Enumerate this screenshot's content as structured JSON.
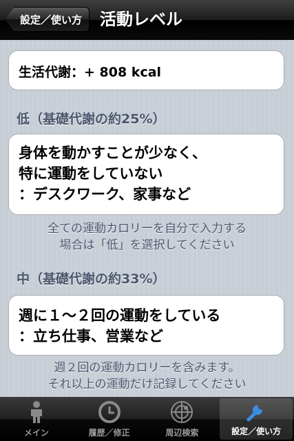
{
  "nav": {
    "back_label": "設定／使い方",
    "title": "活動レベル"
  },
  "summary": {
    "text": "生活代謝：+ 808 kcal"
  },
  "sections": [
    {
      "header": "低（基礎代謝の約25%）",
      "lines": [
        "身体を動かすことが少なく、",
        "特に運動をしていない",
        "：デスクワーク、家事など"
      ],
      "footnote": [
        "全ての運動カロリーを自分で入力する",
        "場合は「低」を選択してください"
      ]
    },
    {
      "header": "中（基礎代謝の約33%）",
      "lines": [
        "週に１〜２回の運動をしている",
        "：立ち仕事、営業など"
      ],
      "footnote": [
        "週２回の運動カロリーを含みます。",
        "それ以上の運動だけ記録してください"
      ]
    }
  ],
  "tabs": [
    {
      "label": "メイン",
      "icon": "person-icon"
    },
    {
      "label": "履歴／修正",
      "icon": "clock-icon"
    },
    {
      "label": "周辺検索",
      "icon": "radar-icon"
    },
    {
      "label": "設定／使い方",
      "icon": "wrench-icon",
      "active": true
    }
  ],
  "colors": {
    "background": "#c5ccd4",
    "section_text": "#4c566c",
    "tab_active_tint": "#4a90e2"
  }
}
